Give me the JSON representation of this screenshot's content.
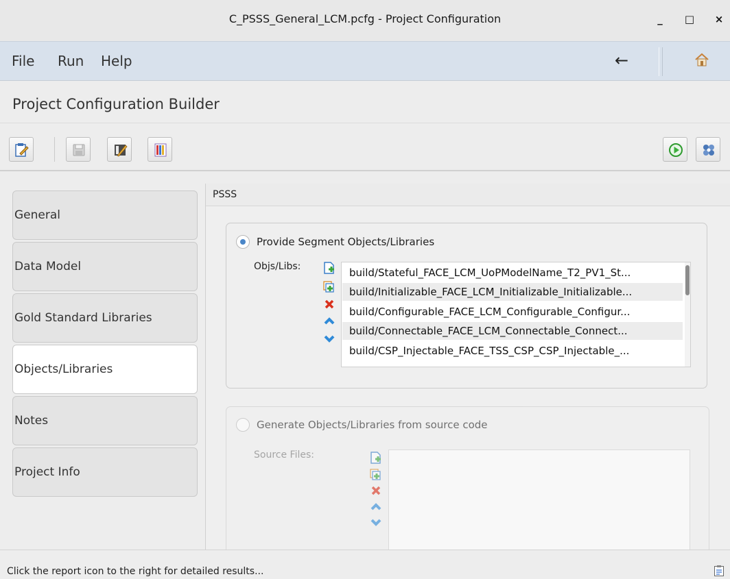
{
  "window": {
    "title": "C_PSSS_General_LCM.pcfg - Project Configuration",
    "controls": {
      "minimize": "_",
      "maximize": "□",
      "close": "×"
    }
  },
  "menubar": {
    "items": [
      "File",
      "Run",
      "Help"
    ],
    "back_icon": "arrow-left-icon",
    "home_icon": "home-icon"
  },
  "builder": {
    "title": "Project Configuration Builder"
  },
  "toolbar": {
    "left": [
      "edit-config-icon",
      "save-icon",
      "save-as-icon",
      "report-chart-icon"
    ],
    "right": [
      "run-icon",
      "settings-icon"
    ]
  },
  "sidebar": {
    "items": [
      {
        "label": "General",
        "active": false
      },
      {
        "label": "Data Model",
        "active": false
      },
      {
        "label": "Gold Standard Libraries",
        "active": false
      },
      {
        "label": "Objects/Libraries",
        "active": true
      },
      {
        "label": "Notes",
        "active": false
      },
      {
        "label": "Project Info",
        "active": false
      }
    ]
  },
  "content": {
    "section_title": "PSSS",
    "provide": {
      "radio_label": "Provide Segment Objects/Libraries",
      "selected": true,
      "list_label": "Objs/Libs:",
      "items": [
        "build/Stateful_FACE_LCM_UoPModelName_T2_PV1_St...",
        "build/Initializable_FACE_LCM_Initializable_Initializable...",
        "build/Configurable_FACE_LCM_Configurable_Configur...",
        "build/Connectable_FACE_LCM_Connectable_Connect...",
        "build/CSP_Injectable_FACE_TSS_CSP_CSP_Injectable_..."
      ]
    },
    "generate": {
      "radio_label": "Generate Objects/Libraries from source code",
      "selected": false,
      "list_label": "Source Files:",
      "items": []
    },
    "list_actions": [
      "add-file-icon",
      "add-folder-icon",
      "delete-icon",
      "move-up-icon",
      "move-down-icon"
    ]
  },
  "status": {
    "message": "Click the report icon to the right for detailed results...",
    "report_icon": "report-icon"
  },
  "colors": {
    "menubar_bg": "#d8e1ec",
    "radio_selected": "#4a86c8",
    "add_green": "#3aa43a",
    "delete_red": "#d9301c",
    "arrow_blue": "#2f8ad8",
    "run_green": "#3cae3c"
  }
}
